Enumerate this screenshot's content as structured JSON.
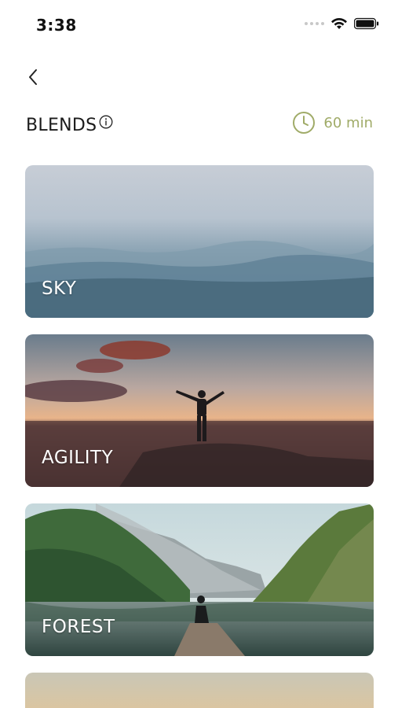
{
  "status_bar": {
    "time": "3:38"
  },
  "header": {
    "title": "BLENDS",
    "duration": "60 min"
  },
  "colors": {
    "accent": "#a0ab68",
    "text": "#1b1b1b"
  },
  "blends": [
    {
      "label": "SKY"
    },
    {
      "label": "AGILITY"
    },
    {
      "label": "FOREST"
    }
  ],
  "icons": {
    "back": "chevron-left-icon",
    "info": "info-icon",
    "duration": "clock-icon",
    "wifi": "wifi-icon",
    "battery": "battery-icon"
  }
}
